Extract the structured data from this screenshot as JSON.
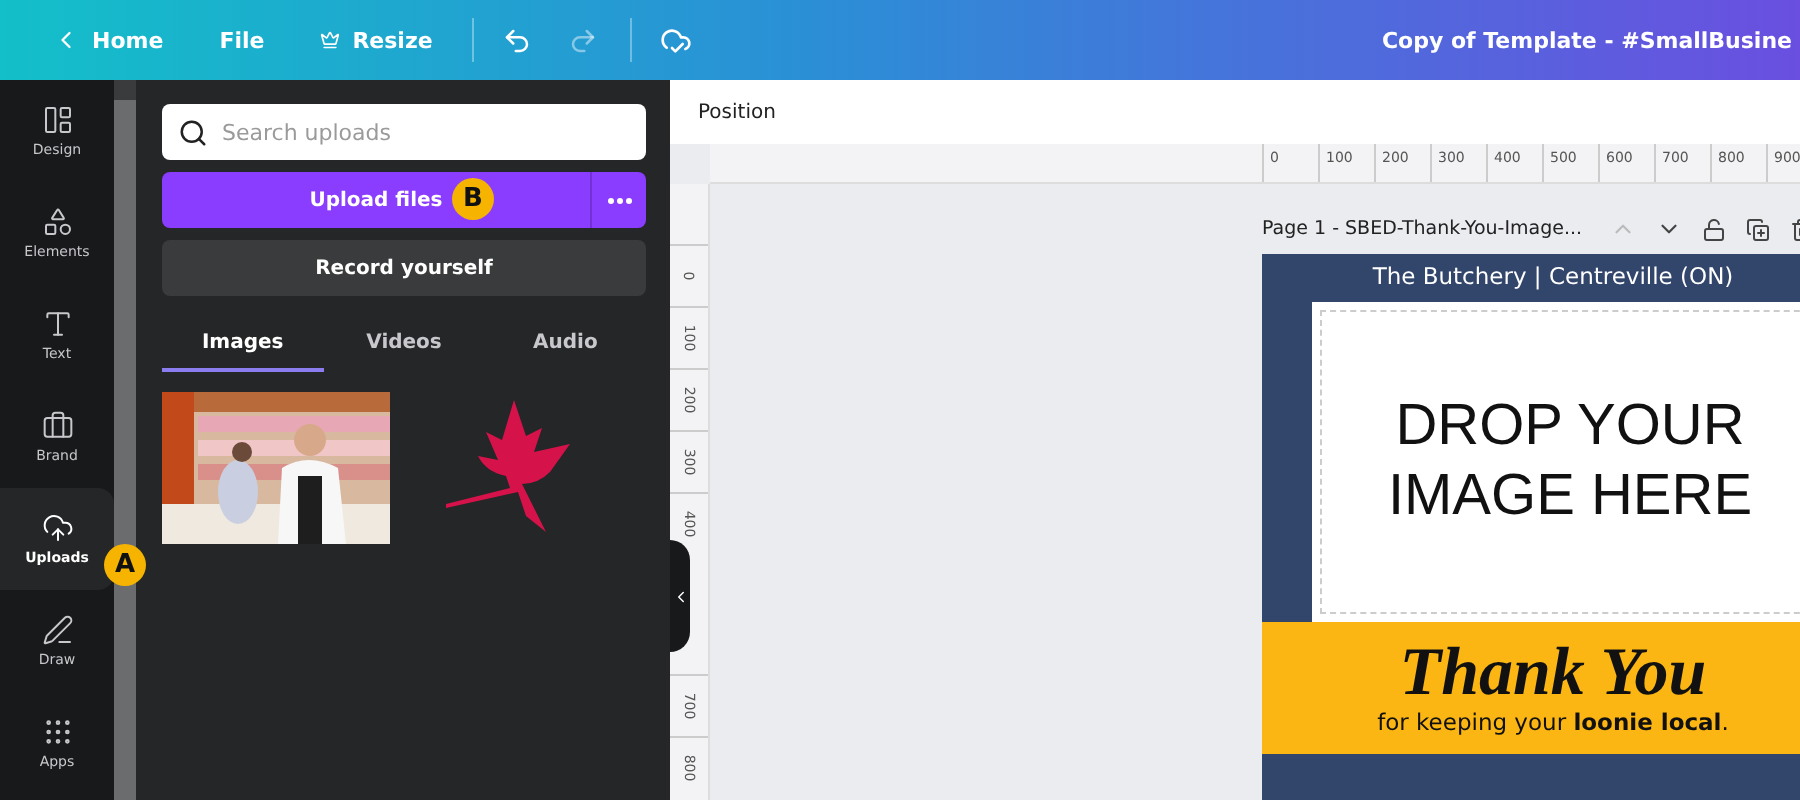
{
  "top_bar": {
    "home": "Home",
    "file": "File",
    "resize": "Resize",
    "title": "Copy of Template - #SmallBusine"
  },
  "sidebar": {
    "items": [
      {
        "label": "Design",
        "selected": false
      },
      {
        "label": "Elements",
        "selected": false
      },
      {
        "label": "Text",
        "selected": false
      },
      {
        "label": "Brand",
        "selected": false
      },
      {
        "label": "Uploads",
        "selected": true
      },
      {
        "label": "Draw",
        "selected": false
      },
      {
        "label": "Apps",
        "selected": false
      }
    ]
  },
  "panel": {
    "search": {
      "placeholder": "Search uploads"
    },
    "upload_button": "Upload files",
    "record_button": "Record yourself",
    "tabs": [
      {
        "label": "Images",
        "selected": true
      },
      {
        "label": "Videos",
        "selected": false
      },
      {
        "label": "Audio",
        "selected": false
      }
    ],
    "uploads": [
      {
        "kind": "picture"
      },
      {
        "kind": "leaf"
      }
    ]
  },
  "markers": [
    {
      "label": "A"
    },
    {
      "label": "B"
    }
  ],
  "toolbar": {
    "label": "Position"
  },
  "ruler": {
    "horizontal": [
      "0",
      "100",
      "200",
      "300",
      "400",
      "500",
      "600",
      "700",
      "800",
      "900"
    ],
    "vertical_upper": [
      "0",
      "100",
      "200",
      "300",
      "400"
    ],
    "vertical_lower": [
      "700",
      "800"
    ]
  },
  "page": {
    "title": "Page 1 - SBED-Thank-You-Image...",
    "header": "The Butchery | Centreville (ON)",
    "drop_text": "DROP YOUR IMAGE HERE",
    "thank_you": "Thank You",
    "tagline": "for keeping your **loonie local**."
  }
}
